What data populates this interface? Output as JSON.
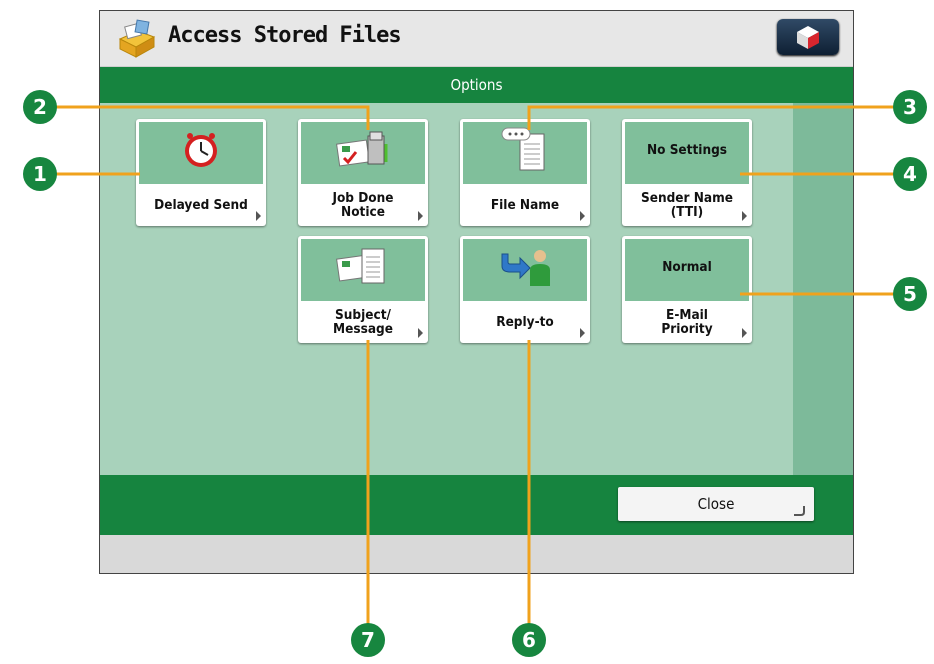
{
  "header": {
    "title": "Access Stored Files"
  },
  "options_bar": {
    "title": "Options"
  },
  "buttons": [
    {
      "label": "Delayed Send",
      "setting": "",
      "icon": "clock-icon"
    },
    {
      "label": "Job Done\nNotice",
      "setting": "",
      "icon": "notification-printer-icon"
    },
    {
      "label": "File Name",
      "setting": "",
      "icon": "document-name-icon"
    },
    {
      "label": "Sender Name\n(TTI)",
      "setting": "No Settings",
      "icon": ""
    },
    {
      "label": "Subject/\nMessage",
      "setting": "",
      "icon": "message-document-icon"
    },
    {
      "label": "Reply-to",
      "setting": "",
      "icon": "reply-user-icon"
    },
    {
      "label": "E-Mail\nPriority",
      "setting": "Normal",
      "icon": ""
    }
  ],
  "close_button": {
    "label": "Close"
  },
  "callouts": [
    "1",
    "2",
    "3",
    "4",
    "5",
    "6",
    "7"
  ],
  "colors": {
    "accent_green": "#16843f",
    "callout_line": "#f0a21c",
    "panel_bg": "#a8d2bb"
  }
}
